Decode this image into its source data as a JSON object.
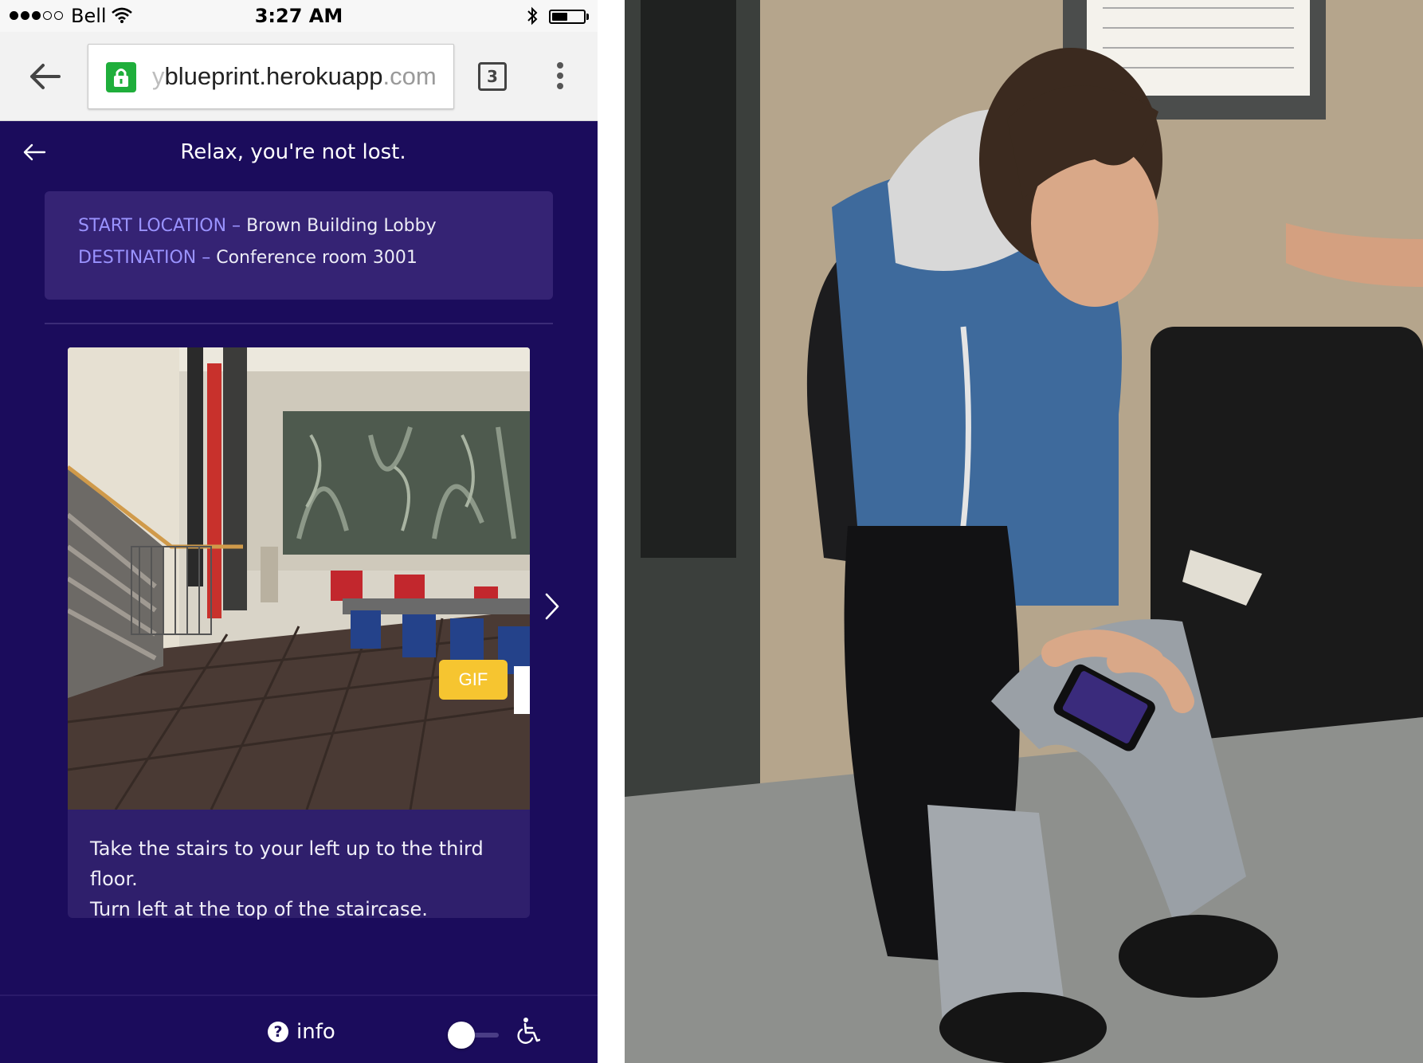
{
  "status_bar": {
    "carrier": "Bell",
    "time": "3:27 AM",
    "signal_bars_filled": 3,
    "signal_bars_total": 5,
    "battery_level": 0.5,
    "icons": [
      "wifi-icon",
      "bluetooth-icon",
      "battery-icon"
    ]
  },
  "browser": {
    "url_prefix": "y",
    "url_host": "blueprint.herokuapp",
    "url_suffix": ".com",
    "tab_count": "3",
    "icons": [
      "back-arrow-icon",
      "lock-icon",
      "tab-switcher-icon",
      "menu-kebab-icon"
    ]
  },
  "app": {
    "title": "Relax, you're not lost.",
    "route": {
      "start_label": "START LOCATION –",
      "start_value": "Brown Building Lobby",
      "destination_label": "DESTINATION –",
      "destination_value": "Conference room 3001"
    },
    "step": {
      "badge": "GIF",
      "instruction_line1": "Take the stairs to your left up to the third floor.",
      "instruction_line2": "Turn left at the top of the staircase."
    },
    "footer": {
      "info_label": "info",
      "accessibility_toggle_on": false
    },
    "colors": {
      "background": "#1b0c5c",
      "card": "#352374",
      "key_text": "#9a93ff",
      "badge": "#f6c530"
    },
    "icons": [
      "back-arrow-icon",
      "next-chevron-icon",
      "question-icon",
      "wheelchair-icon"
    ]
  }
}
